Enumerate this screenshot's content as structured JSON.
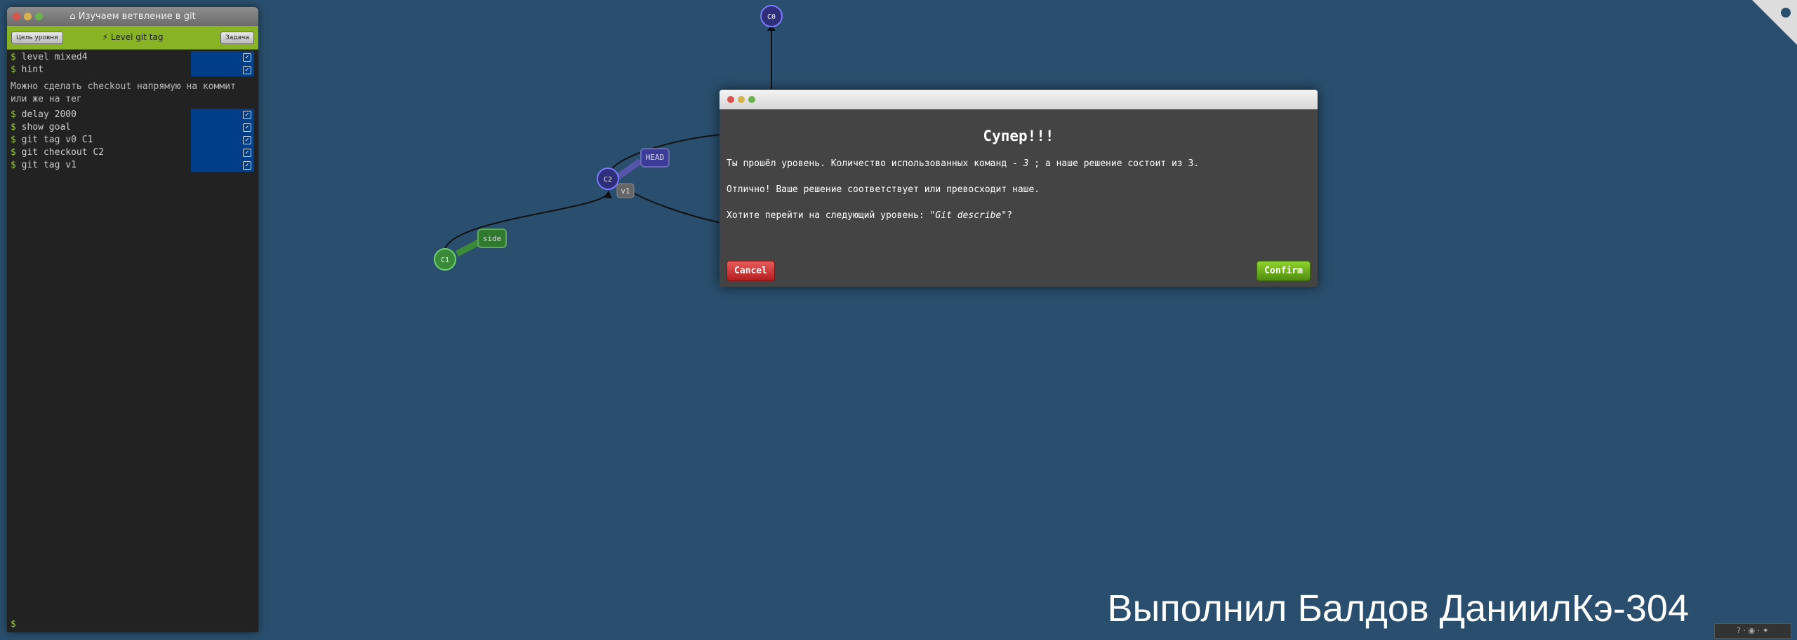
{
  "terminal": {
    "title": "Изучаем ветвление в git",
    "title_icon": "home-icon",
    "goal_button": "Цель уровня",
    "level_label": "Level git tag",
    "level_icon": "bolt-icon",
    "task_button": "Задача",
    "commands_top": [
      "level mixed4",
      "hint"
    ],
    "hint_text": "Можно сделать checkout напрямую на коммит или же на тег",
    "commands_bottom": [
      "delay 2000",
      "show goal",
      "git tag v0 C1",
      "git checkout C2",
      "git tag v1"
    ],
    "prompt": "$",
    "status_color": "#003f87"
  },
  "tree": {
    "nodes": [
      "C0",
      "C1",
      "C2"
    ],
    "branches": [
      "HEAD",
      "side"
    ],
    "tags": [
      "v1"
    ],
    "colors": {
      "main_commit": "#2e2e7a",
      "side_commit": "#3a8a3a",
      "head_label": "#3b3b99",
      "side_label": "#2f7a2f"
    }
  },
  "modal": {
    "heading": "Супер!!!",
    "line1_before": "Ты прошёл уровень. Количество использованных команд - ",
    "line1_count": "3",
    "line1_after": " ; а наше решение состоит из 3.",
    "line2": "Отлично! Ваше решение соответствует или превосходит наше.",
    "line3_before": "Хотите перейти на следующий уровень: ",
    "line3_level": "\"Git describe\"",
    "line3_after": "?",
    "cancel": "Cancel",
    "confirm": "Confirm"
  },
  "signature": "Выполнил Балдов ДаниилКэ-304",
  "bottom_bar": "? · ◉ · ✦"
}
